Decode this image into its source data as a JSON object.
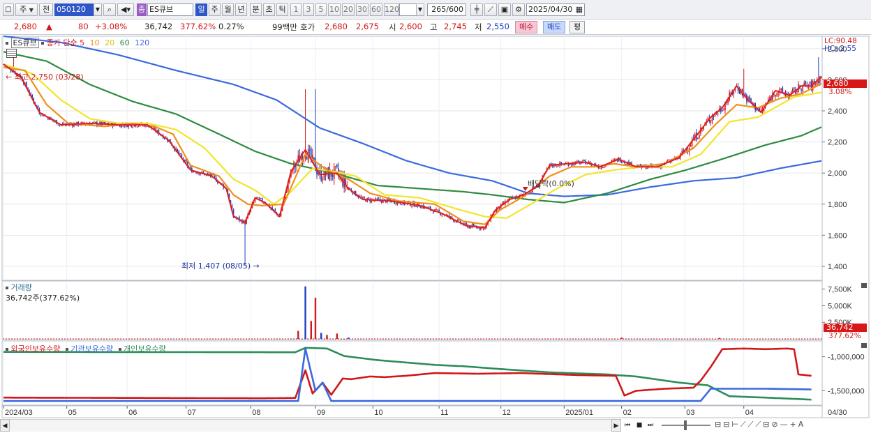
{
  "toolbar": {
    "period_label": "주",
    "prev_label": "전",
    "code_value": "050120",
    "stock_name": "ES큐브",
    "stock_type_badge": "종",
    "tf_day": "일",
    "tf_week": "주",
    "tf_month": "월",
    "tf_year": "년",
    "tf_minute": "분",
    "tf_second": "초",
    "tf_tick": "틱",
    "intervals": [
      "1",
      "3",
      "5",
      "10",
      "20",
      "30",
      "60",
      "120"
    ],
    "count_value": "265",
    "count_max": "/600",
    "date_value": "2025/04/30"
  },
  "quote": {
    "price": "2,680",
    "change_arrow": "▲",
    "change": "80",
    "change_pct": "+3.08%",
    "volume": "36,742",
    "volume_ratio": "377.62%",
    "turnover_pct": "0.27%",
    "amount": "99백만",
    "bid_label": "호가",
    "ask_price": "2,680",
    "bid_price": "2,675",
    "open_label": "시",
    "open": "2,600",
    "high_label": "고",
    "high": "2,745",
    "low_label": "저",
    "low": "2,550",
    "buy_btn": "매수",
    "sell_btn": "매도",
    "eval_btn": "평"
  },
  "legend": {
    "symbol": "ES큐브",
    "close_label": "종가 단순",
    "ma5": "5",
    "ma10": "10",
    "ma20": "20",
    "ma60": "60",
    "ma120": "120"
  },
  "colors": {
    "up": "#d01818",
    "down": "#1c3fc0",
    "ma5": "#e02020",
    "ma10": "#ef8f1c",
    "ma20": "#f2e52a",
    "ma60": "#2e8b3e",
    "ma120": "#3a6ae0",
    "foreign": "#d01818",
    "institution": "#3a6ae0",
    "individual": "#2e8b5a"
  },
  "annotations": {
    "high": "최고 2,750 (03/28)",
    "low": "최저 1,407 (08/05)",
    "dividend": "배당락(0.0%)"
  },
  "right_labels": {
    "lc": "LC:90.48",
    "hc": "HC:-2.55",
    "last_price": "2,680",
    "last_pct": "3.08%",
    "last_volume": "36,742",
    "last_volume_pct": "377.62%"
  },
  "volume_panel": {
    "title": "거래량",
    "value": "36,742주(377.62%)",
    "ticks": [
      "7,500K",
      "5,000K",
      "2,500K"
    ]
  },
  "holdings_panel": {
    "foreign": "외국인보유수량",
    "institution": "기관보유수량",
    "individual": "개인보유수량",
    "ticks": [
      "-1,000,000",
      "-1,500,000"
    ]
  },
  "x_axis": {
    "labels": [
      "2024/03",
      "05",
      "06",
      "07",
      "08",
      "09",
      "10",
      "11",
      "12",
      "2025/01",
      "02",
      "03",
      "04"
    ],
    "end_label": "04/30"
  },
  "chart_data": {
    "type": "candlestick",
    "y_ticks": [
      2800,
      2600,
      2400,
      2200,
      2000,
      1800,
      1600,
      1400
    ],
    "ylim": [
      1310,
      2880
    ],
    "volume_ylim": [
      0,
      8500
    ],
    "holdings_ticks": [
      -1000000,
      -1500000
    ],
    "series_names": [
      "5",
      "10",
      "20",
      "60",
      "120"
    ],
    "high_point": {
      "value": 2750,
      "date": "03/28"
    },
    "low_point": {
      "value": 1407,
      "date": "08/05"
    },
    "ma_anchors": {
      "ma5": [
        [
          0,
          2700
        ],
        [
          12,
          2620
        ],
        [
          25,
          2390
        ],
        [
          40,
          2310
        ],
        [
          60,
          2320
        ],
        [
          80,
          2310
        ],
        [
          100,
          2310
        ],
        [
          115,
          2210
        ],
        [
          130,
          2020
        ],
        [
          145,
          1980
        ],
        [
          155,
          1900
        ],
        [
          160,
          1720
        ],
        [
          168,
          1680
        ],
        [
          175,
          1840
        ],
        [
          182,
          1810
        ],
        [
          192,
          1720
        ],
        [
          200,
          2010
        ],
        [
          210,
          2150
        ],
        [
          220,
          1990
        ],
        [
          232,
          2000
        ],
        [
          240,
          1900
        ],
        [
          250,
          1830
        ],
        [
          270,
          1820
        ],
        [
          290,
          1790
        ],
        [
          305,
          1740
        ],
        [
          322,
          1660
        ],
        [
          335,
          1650
        ],
        [
          342,
          1760
        ],
        [
          352,
          1830
        ],
        [
          362,
          1860
        ],
        [
          372,
          1920
        ],
        [
          380,
          2050
        ],
        [
          392,
          2060
        ],
        [
          405,
          2070
        ],
        [
          415,
          2040
        ],
        [
          428,
          2090
        ],
        [
          440,
          2040
        ],
        [
          455,
          2040
        ],
        [
          470,
          2100
        ],
        [
          482,
          2240
        ],
        [
          492,
          2360
        ],
        [
          500,
          2420
        ],
        [
          510,
          2560
        ],
        [
          518,
          2470
        ],
        [
          527,
          2390
        ],
        [
          537,
          2530
        ],
        [
          547,
          2500
        ],
        [
          555,
          2560
        ],
        [
          562,
          2560
        ],
        [
          570,
          2630
        ]
      ],
      "ma10": [
        [
          0,
          2680
        ],
        [
          15,
          2660
        ],
        [
          30,
          2440
        ],
        [
          45,
          2320
        ],
        [
          70,
          2300
        ],
        [
          90,
          2320
        ],
        [
          105,
          2300
        ],
        [
          118,
          2250
        ],
        [
          130,
          2050
        ],
        [
          150,
          1980
        ],
        [
          160,
          1860
        ],
        [
          170,
          1800
        ],
        [
          180,
          1790
        ],
        [
          195,
          1800
        ],
        [
          210,
          2120
        ],
        [
          225,
          2020
        ],
        [
          240,
          1960
        ],
        [
          255,
          1870
        ],
        [
          275,
          1820
        ],
        [
          300,
          1800
        ],
        [
          320,
          1690
        ],
        [
          335,
          1670
        ],
        [
          345,
          1760
        ],
        [
          362,
          1850
        ],
        [
          380,
          1980
        ],
        [
          395,
          2040
        ],
        [
          410,
          2040
        ],
        [
          425,
          2060
        ],
        [
          440,
          2040
        ],
        [
          460,
          2060
        ],
        [
          480,
          2160
        ],
        [
          495,
          2310
        ],
        [
          510,
          2440
        ],
        [
          525,
          2420
        ],
        [
          540,
          2480
        ],
        [
          555,
          2510
        ],
        [
          570,
          2580
        ]
      ],
      "ma20": [
        [
          0,
          2700
        ],
        [
          20,
          2640
        ],
        [
          40,
          2470
        ],
        [
          60,
          2350
        ],
        [
          80,
          2320
        ],
        [
          100,
          2320
        ],
        [
          120,
          2280
        ],
        [
          140,
          2160
        ],
        [
          160,
          1960
        ],
        [
          175,
          1890
        ],
        [
          188,
          1800
        ],
        [
          200,
          1880
        ],
        [
          215,
          2030
        ],
        [
          230,
          2010
        ],
        [
          245,
          1980
        ],
        [
          265,
          1860
        ],
        [
          290,
          1840
        ],
        [
          315,
          1770
        ],
        [
          335,
          1720
        ],
        [
          350,
          1710
        ],
        [
          365,
          1790
        ],
        [
          385,
          1900
        ],
        [
          405,
          1990
        ],
        [
          425,
          2020
        ],
        [
          445,
          2040
        ],
        [
          465,
          2040
        ],
        [
          485,
          2120
        ],
        [
          505,
          2330
        ],
        [
          525,
          2360
        ],
        [
          550,
          2490
        ],
        [
          570,
          2520
        ]
      ],
      "ma60": [
        [
          0,
          2780
        ],
        [
          30,
          2720
        ],
        [
          60,
          2570
        ],
        [
          90,
          2460
        ],
        [
          120,
          2380
        ],
        [
          150,
          2250
        ],
        [
          175,
          2140
        ],
        [
          200,
          2060
        ],
        [
          230,
          2000
        ],
        [
          260,
          1920
        ],
        [
          290,
          1900
        ],
        [
          320,
          1880
        ],
        [
          340,
          1860
        ],
        [
          365,
          1830
        ],
        [
          390,
          1810
        ],
        [
          420,
          1870
        ],
        [
          450,
          1960
        ],
        [
          475,
          2020
        ],
        [
          500,
          2090
        ],
        [
          530,
          2180
        ],
        [
          555,
          2240
        ],
        [
          570,
          2300
        ]
      ],
      "ma120": [
        [
          0,
          2880
        ],
        [
          40,
          2840
        ],
        [
          80,
          2760
        ],
        [
          120,
          2660
        ],
        [
          160,
          2570
        ],
        [
          190,
          2470
        ],
        [
          220,
          2290
        ],
        [
          250,
          2190
        ],
        [
          280,
          2080
        ],
        [
          310,
          2000
        ],
        [
          340,
          1950
        ],
        [
          365,
          1870
        ],
        [
          390,
          1850
        ],
        [
          420,
          1860
        ],
        [
          450,
          1910
        ],
        [
          480,
          1950
        ],
        [
          510,
          1970
        ],
        [
          540,
          2030
        ],
        [
          570,
          2080
        ]
      ]
    },
    "volume_spikes": [
      [
        205,
        1200
      ],
      [
        210,
        7900
      ],
      [
        214,
        2700
      ],
      [
        217,
        6200
      ],
      [
        221,
        900
      ],
      [
        225,
        600
      ],
      [
        232,
        800
      ],
      [
        240,
        200
      ],
      [
        430,
        200
      ],
      [
        498,
        150
      ]
    ],
    "holdings": {
      "foreign": [
        [
          0,
          1600000
        ],
        [
          180,
          1610000
        ],
        [
          203,
          1605000
        ],
        [
          210,
          1200000
        ],
        [
          215,
          1540000
        ],
        [
          222,
          1380000
        ],
        [
          228,
          1560000
        ],
        [
          236,
          1320000
        ],
        [
          242,
          1330000
        ],
        [
          255,
          1290000
        ],
        [
          265,
          1300000
        ],
        [
          280,
          1280000
        ],
        [
          300,
          1240000
        ],
        [
          330,
          1250000
        ],
        [
          360,
          1240000
        ],
        [
          400,
          1270000
        ],
        [
          426,
          1280000
        ],
        [
          432,
          1570000
        ],
        [
          440,
          1500000
        ],
        [
          460,
          1470000
        ],
        [
          480,
          1455000
        ],
        [
          485,
          1350000
        ],
        [
          492,
          1150000
        ],
        [
          500,
          890000
        ],
        [
          515,
          880000
        ],
        [
          530,
          890000
        ],
        [
          545,
          880000
        ],
        [
          550,
          890000
        ],
        [
          553,
          1260000
        ],
        [
          562,
          1280000
        ]
      ],
      "institution": [
        [
          0,
          1650000
        ],
        [
          205,
          1650000
        ],
        [
          210,
          880000
        ],
        [
          217,
          1500000
        ],
        [
          222,
          1380000
        ],
        [
          228,
          1650000
        ],
        [
          240,
          1650000
        ],
        [
          485,
          1650000
        ],
        [
          492,
          1470000
        ],
        [
          530,
          1470000
        ],
        [
          562,
          1480000
        ]
      ],
      "individual": [
        [
          0,
          930000
        ],
        [
          203,
          935000
        ],
        [
          210,
          870000
        ],
        [
          225,
          880000
        ],
        [
          237,
          990000
        ],
        [
          260,
          1050000
        ],
        [
          300,
          1120000
        ],
        [
          320,
          1140000
        ],
        [
          345,
          1180000
        ],
        [
          380,
          1230000
        ],
        [
          420,
          1260000
        ],
        [
          440,
          1290000
        ],
        [
          470,
          1380000
        ],
        [
          490,
          1420000
        ],
        [
          505,
          1580000
        ],
        [
          530,
          1600000
        ],
        [
          562,
          1630000
        ]
      ]
    }
  }
}
